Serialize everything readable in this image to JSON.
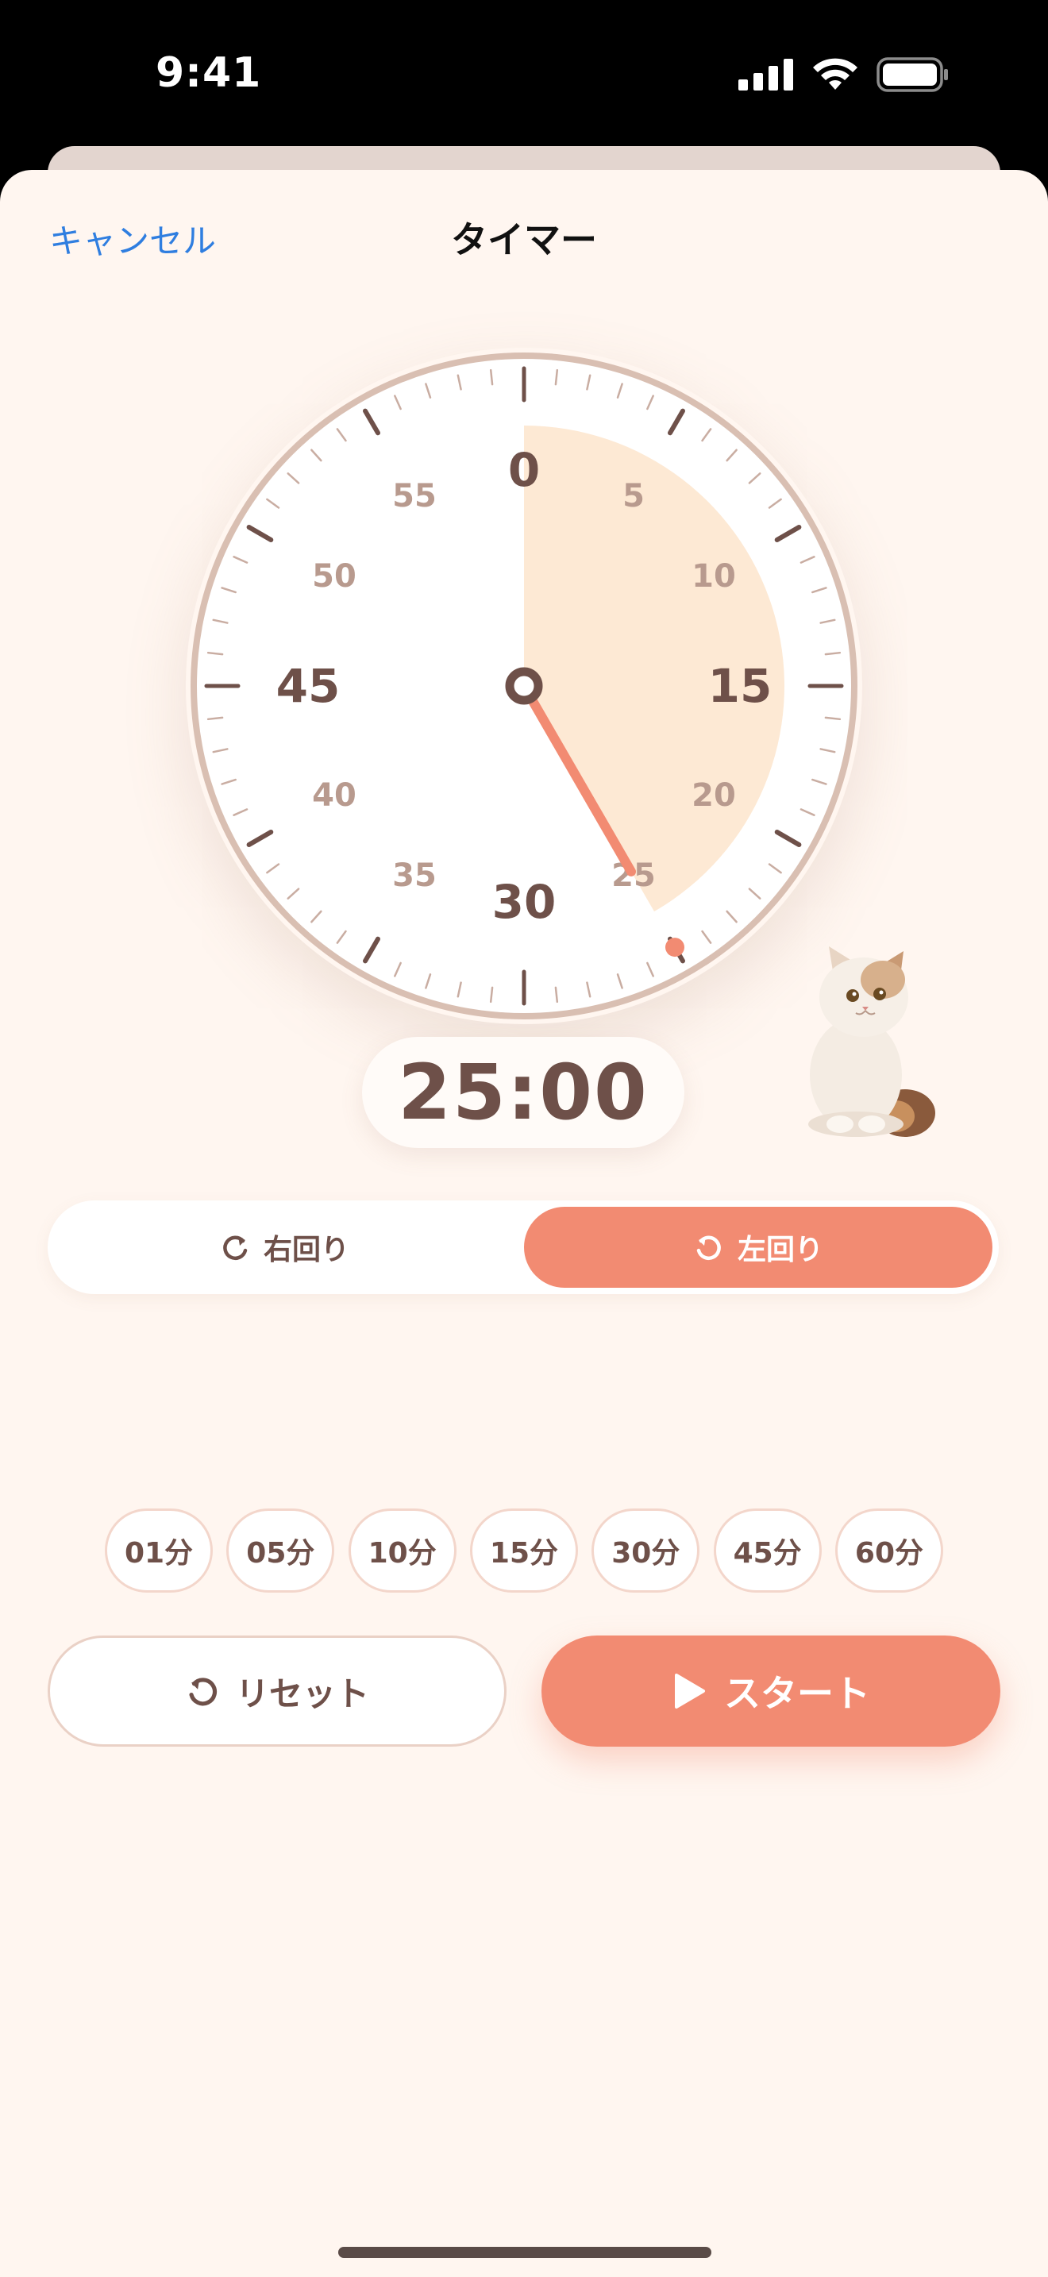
{
  "status_bar": {
    "time": "9:41"
  },
  "nav": {
    "cancel": "キャンセル",
    "title": "タイマー"
  },
  "dial": {
    "major_labels": [
      "0",
      "15",
      "30",
      "45"
    ],
    "minor_labels": [
      "5",
      "10",
      "20",
      "25",
      "35",
      "40",
      "50",
      "55"
    ],
    "set_minutes": 25,
    "sector_color": "#fde9d4",
    "hand_color": "#f28b72",
    "rim_color": "#d9bfb2",
    "tick_color": "#6e5049",
    "minor_label_color": "#b89a8e"
  },
  "readout": {
    "time": "25:00"
  },
  "direction": {
    "clockwise": "右回り",
    "counterclockwise": "左回り",
    "selected": "counterclockwise"
  },
  "presets": [
    "01分",
    "05分",
    "10分",
    "15分",
    "30分",
    "45分",
    "60分"
  ],
  "actions": {
    "reset": "リセット",
    "start": "スタート"
  },
  "colors": {
    "accent": "#f28b72",
    "text": "#6e5049",
    "background": "#fff6f0",
    "link": "#2f7ee0"
  }
}
